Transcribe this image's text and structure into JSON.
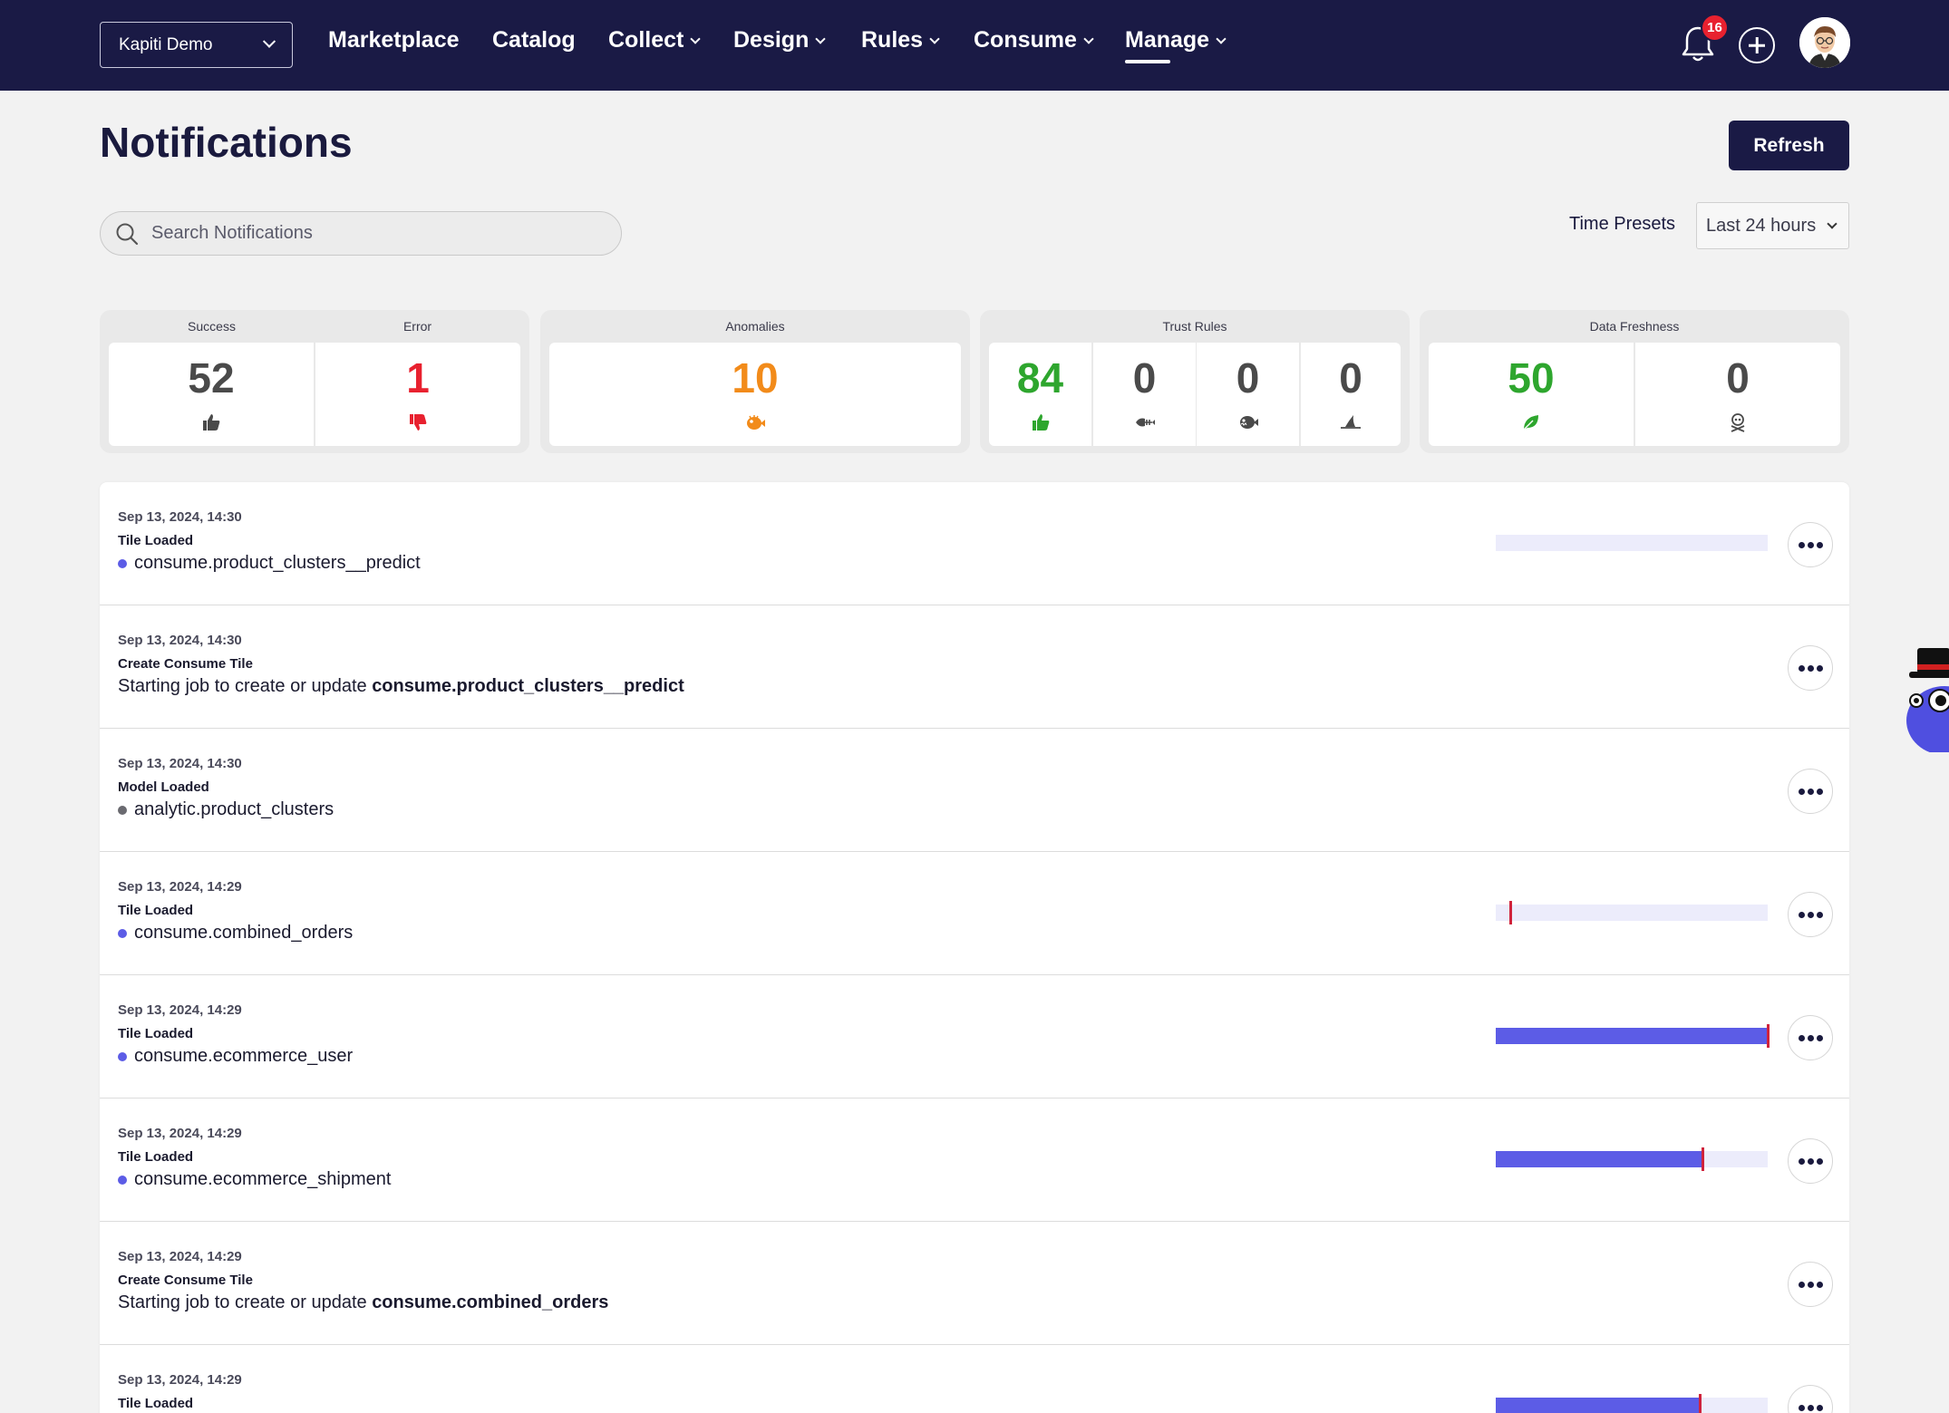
{
  "nav": {
    "workspace": "Kapiti Demo",
    "items": [
      {
        "label": "Marketplace",
        "dropdown": false,
        "active": false
      },
      {
        "label": "Catalog",
        "dropdown": false,
        "active": false
      },
      {
        "label": "Collect",
        "dropdown": true,
        "active": false
      },
      {
        "label": "Design",
        "dropdown": true,
        "active": false
      },
      {
        "label": "Rules",
        "dropdown": true,
        "active": false
      },
      {
        "label": "Consume",
        "dropdown": true,
        "active": false
      },
      {
        "label": "Manage",
        "dropdown": true,
        "active": true
      }
    ],
    "notification_count": "16"
  },
  "header": {
    "title": "Notifications",
    "refresh_label": "Refresh"
  },
  "search": {
    "placeholder": "Search Notifications"
  },
  "time_presets": {
    "label": "Time Presets",
    "selected": "Last 24 hours"
  },
  "stats": {
    "success_label": "Success",
    "success_value": "52",
    "error_label": "Error",
    "error_value": "1",
    "anomalies_label": "Anomalies",
    "anomalies_value": "10",
    "trust_rules_label": "Trust Rules",
    "trust_values": [
      "84",
      "0",
      "0",
      "0"
    ],
    "freshness_label": "Data Freshness",
    "freshness_values": [
      "50",
      "0"
    ]
  },
  "colors": {
    "nav_bg": "#1a1a45",
    "accent": "#5c5ce6",
    "success": "#2ea62e",
    "error": "#e8212f",
    "anomaly": "#f28b1a",
    "marker": "#d0233c"
  },
  "notifications": [
    {
      "time": "Sep 13, 2024, 14:30",
      "title": "Tile Loaded",
      "target": "consume.product_clusters__predict",
      "dot": "purple",
      "bar_fill": 0.0,
      "marker": null
    },
    {
      "time": "Sep 13, 2024, 14:30",
      "title": "Create Consume Tile",
      "prefix": "Starting job to create or update ",
      "target": "consume.product_clusters__predict"
    },
    {
      "time": "Sep 13, 2024, 14:30",
      "title": "Model Loaded",
      "target": "analytic.product_clusters",
      "dot": "gray"
    },
    {
      "time": "Sep 13, 2024, 14:29",
      "title": "Tile Loaded",
      "target": "consume.combined_orders",
      "dot": "purple",
      "bar_fill": 0.0,
      "marker": 0.05
    },
    {
      "time": "Sep 13, 2024, 14:29",
      "title": "Tile Loaded",
      "target": "consume.ecommerce_user",
      "dot": "purple",
      "bar_fill": 1.0,
      "marker": 0.995
    },
    {
      "time": "Sep 13, 2024, 14:29",
      "title": "Tile Loaded",
      "target": "consume.ecommerce_shipment",
      "dot": "purple",
      "bar_fill": 0.76,
      "marker": 0.755
    },
    {
      "time": "Sep 13, 2024, 14:29",
      "title": "Create Consume Tile",
      "prefix": "Starting job to create or update ",
      "target": "consume.combined_orders"
    },
    {
      "time": "Sep 13, 2024, 14:29",
      "title": "Tile Loaded",
      "target": "",
      "dot": "purple",
      "bar_fill": 0.745,
      "marker": 0.745
    }
  ]
}
